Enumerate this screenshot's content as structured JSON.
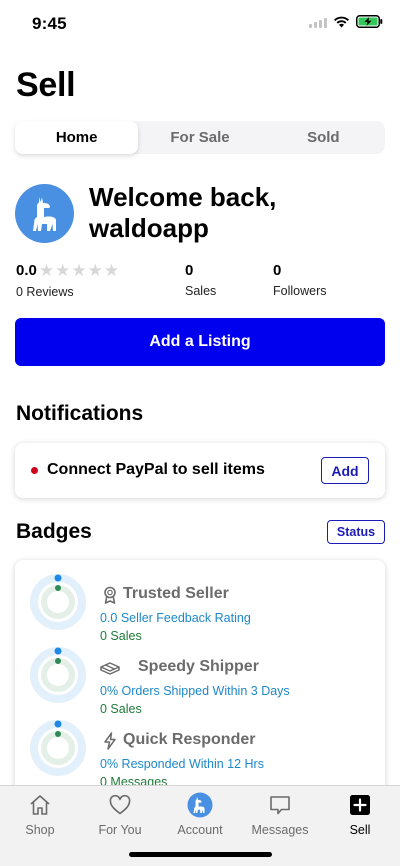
{
  "status_bar": {
    "time": "9:45"
  },
  "page": {
    "title": "Sell"
  },
  "segments": [
    {
      "label": "Home",
      "active": true
    },
    {
      "label": "For Sale",
      "active": false
    },
    {
      "label": "Sold",
      "active": false
    }
  ],
  "profile": {
    "welcome": "Welcome back, waldoapp",
    "avatar_color": "#4a90e2",
    "rating": "0.0",
    "stars": 0,
    "reviews_label": "0 Reviews",
    "sales_num": "0",
    "sales_label": "Sales",
    "followers_num": "0",
    "followers_label": "Followers"
  },
  "add_listing": {
    "label": "Add a Listing"
  },
  "notifications": {
    "title": "Notifications",
    "item": {
      "text": "Connect PayPal to sell items",
      "button": "Add"
    }
  },
  "badges": {
    "title": "Badges",
    "status_button": "Status",
    "items": [
      {
        "title": "Trusted Seller",
        "line1": "0.0 Seller Feedback Rating",
        "line2": "0 Sales",
        "icon": "ribbon-icon"
      },
      {
        "title": "Speedy Shipper",
        "line1": "0% Orders Shipped Within 3 Days",
        "line2": "0 Sales",
        "icon": "shipping-icon"
      },
      {
        "title": "Quick Responder",
        "line1": "0% Responded Within 12 Hrs",
        "line2": "0 Messages",
        "icon": "lightning-icon"
      }
    ]
  },
  "tabbar": {
    "items": [
      {
        "label": "Shop",
        "icon": "home-icon"
      },
      {
        "label": "For You",
        "icon": "heart-icon"
      },
      {
        "label": "Account",
        "icon": "llama-avatar-icon"
      },
      {
        "label": "Messages",
        "icon": "chat-bubble-icon"
      },
      {
        "label": "Sell",
        "icon": "plus-square-icon",
        "active": true
      }
    ]
  },
  "colors": {
    "primary": "#0000ee",
    "accent_blue": "#1e88c8",
    "accent_green": "#1f7a3a",
    "danger": "#d0021b"
  }
}
